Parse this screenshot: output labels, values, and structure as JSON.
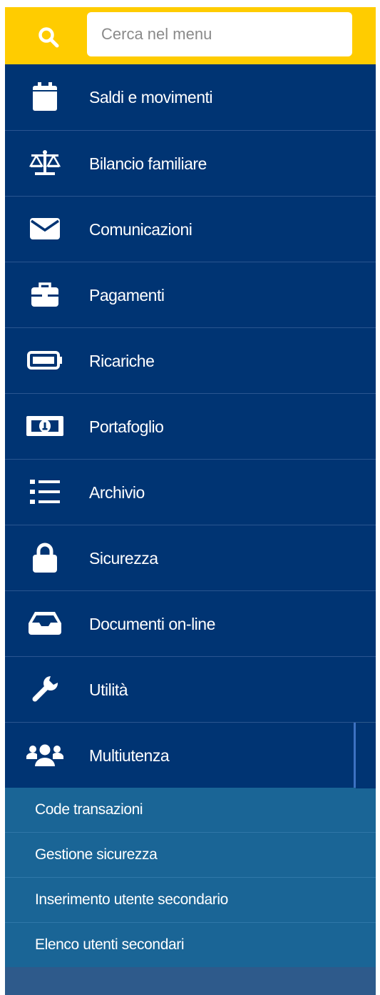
{
  "search": {
    "placeholder": "Cerca nel menu",
    "value": ""
  },
  "menu": {
    "items": [
      {
        "label": "Saldi e movimenti",
        "icon": "calendar-icon"
      },
      {
        "label": "Bilancio familiare",
        "icon": "balance-scale-icon"
      },
      {
        "label": "Comunicazioni",
        "icon": "envelope-icon"
      },
      {
        "label": "Pagamenti",
        "icon": "briefcase-icon"
      },
      {
        "label": "Ricariche",
        "icon": "battery-icon"
      },
      {
        "label": "Portafoglio",
        "icon": "banknote-icon"
      },
      {
        "label": "Archivio",
        "icon": "list-icon"
      },
      {
        "label": "Sicurezza",
        "icon": "lock-icon"
      },
      {
        "label": "Documenti on-line",
        "icon": "inbox-icon"
      },
      {
        "label": "Utilità",
        "icon": "wrench-icon"
      },
      {
        "label": "Multiutenza",
        "icon": "users-icon",
        "expanded": true
      }
    ],
    "submenu": [
      "Code transazioni",
      "Gestione sicurezza",
      "Inserimento utente secondario",
      "Elenco utenti secondari"
    ]
  },
  "colors": {
    "search_bar": "#ffcc00",
    "menu_item_bg": "#003473",
    "submenu_bg": "#1a6596",
    "menu_footer": "#2e5a8b"
  }
}
